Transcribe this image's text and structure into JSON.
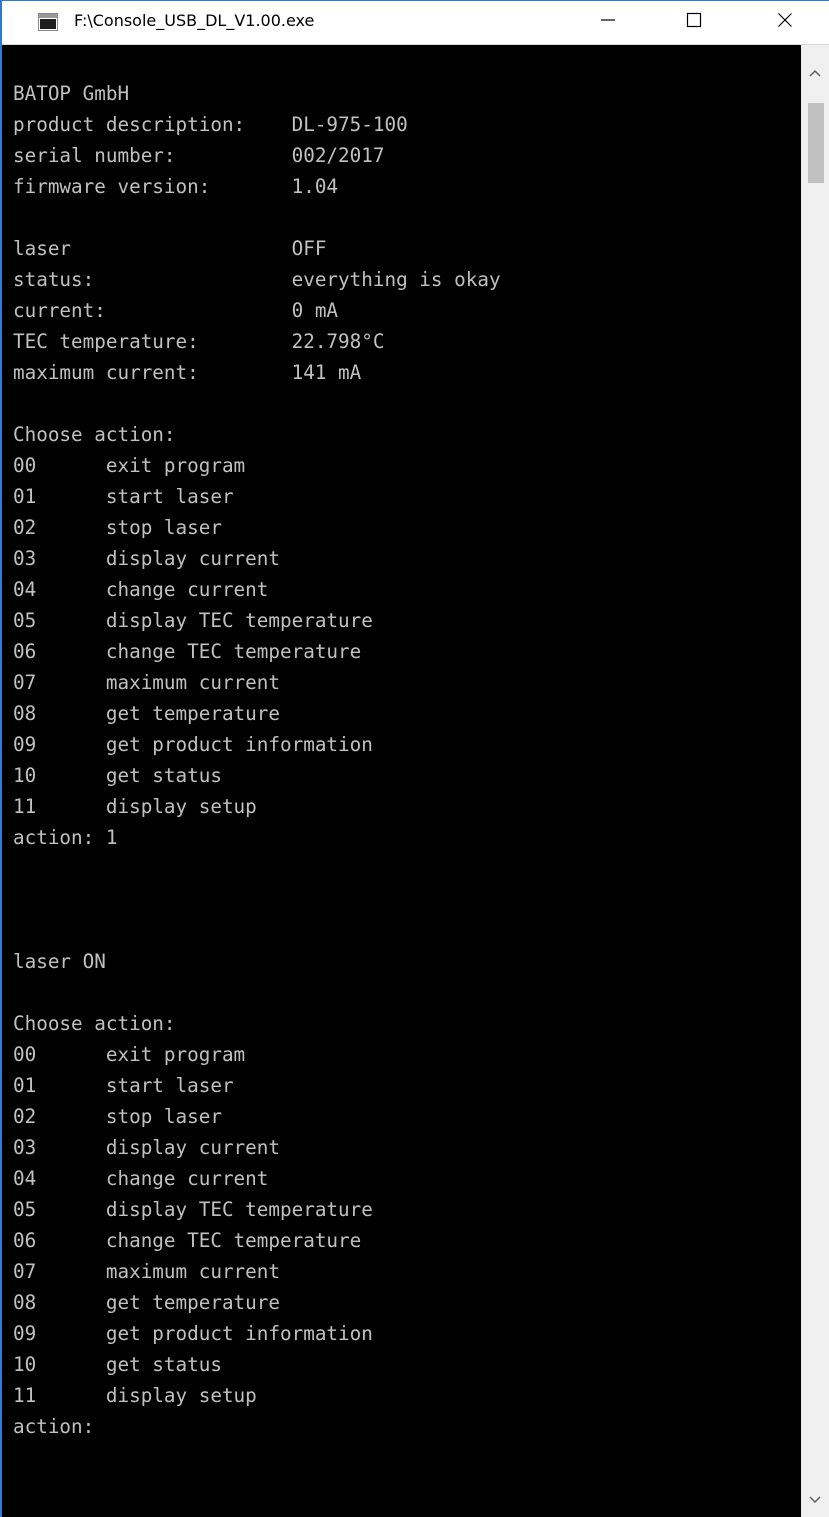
{
  "window": {
    "title": "F:\\Console_USB_DL_V1.00.exe"
  },
  "console": {
    "lines": [
      "BATOP GmbH",
      "product description:    DL-975-100",
      "serial number:          002/2017",
      "firmware version:       1.04",
      "",
      "laser                   OFF",
      "status:                 everything is okay",
      "current:                0 mA",
      "TEC temperature:        22.798°C",
      "maximum current:        141 mA",
      "",
      "Choose action:",
      "00      exit program",
      "01      start laser",
      "02      stop laser",
      "03      display current",
      "04      change current",
      "05      display TEC temperature",
      "06      change TEC temperature",
      "07      maximum current",
      "08      get temperature",
      "09      get product information",
      "10      get status",
      "11      display setup",
      "action: 1",
      "",
      "",
      "",
      "laser ON",
      "",
      "Choose action:",
      "00      exit program",
      "01      start laser",
      "02      stop laser",
      "03      display current",
      "04      change current",
      "05      display TEC temperature",
      "06      change TEC temperature",
      "07      maximum current",
      "08      get temperature",
      "09      get product information",
      "10      get status",
      "11      display setup",
      "action:"
    ]
  },
  "icons": {
    "app": "console-app-icon",
    "minimize": "minimize-icon",
    "maximize": "maximize-icon",
    "close": "close-icon",
    "scroll_up": "scroll-up-arrow-icon",
    "scroll_down": "scroll-down-arrow-icon"
  },
  "colors": {
    "console_background": "#000000",
    "console_text": "#c0c0c0",
    "titlebar_background": "#ffffff",
    "window_border": "#2b7bd6"
  }
}
